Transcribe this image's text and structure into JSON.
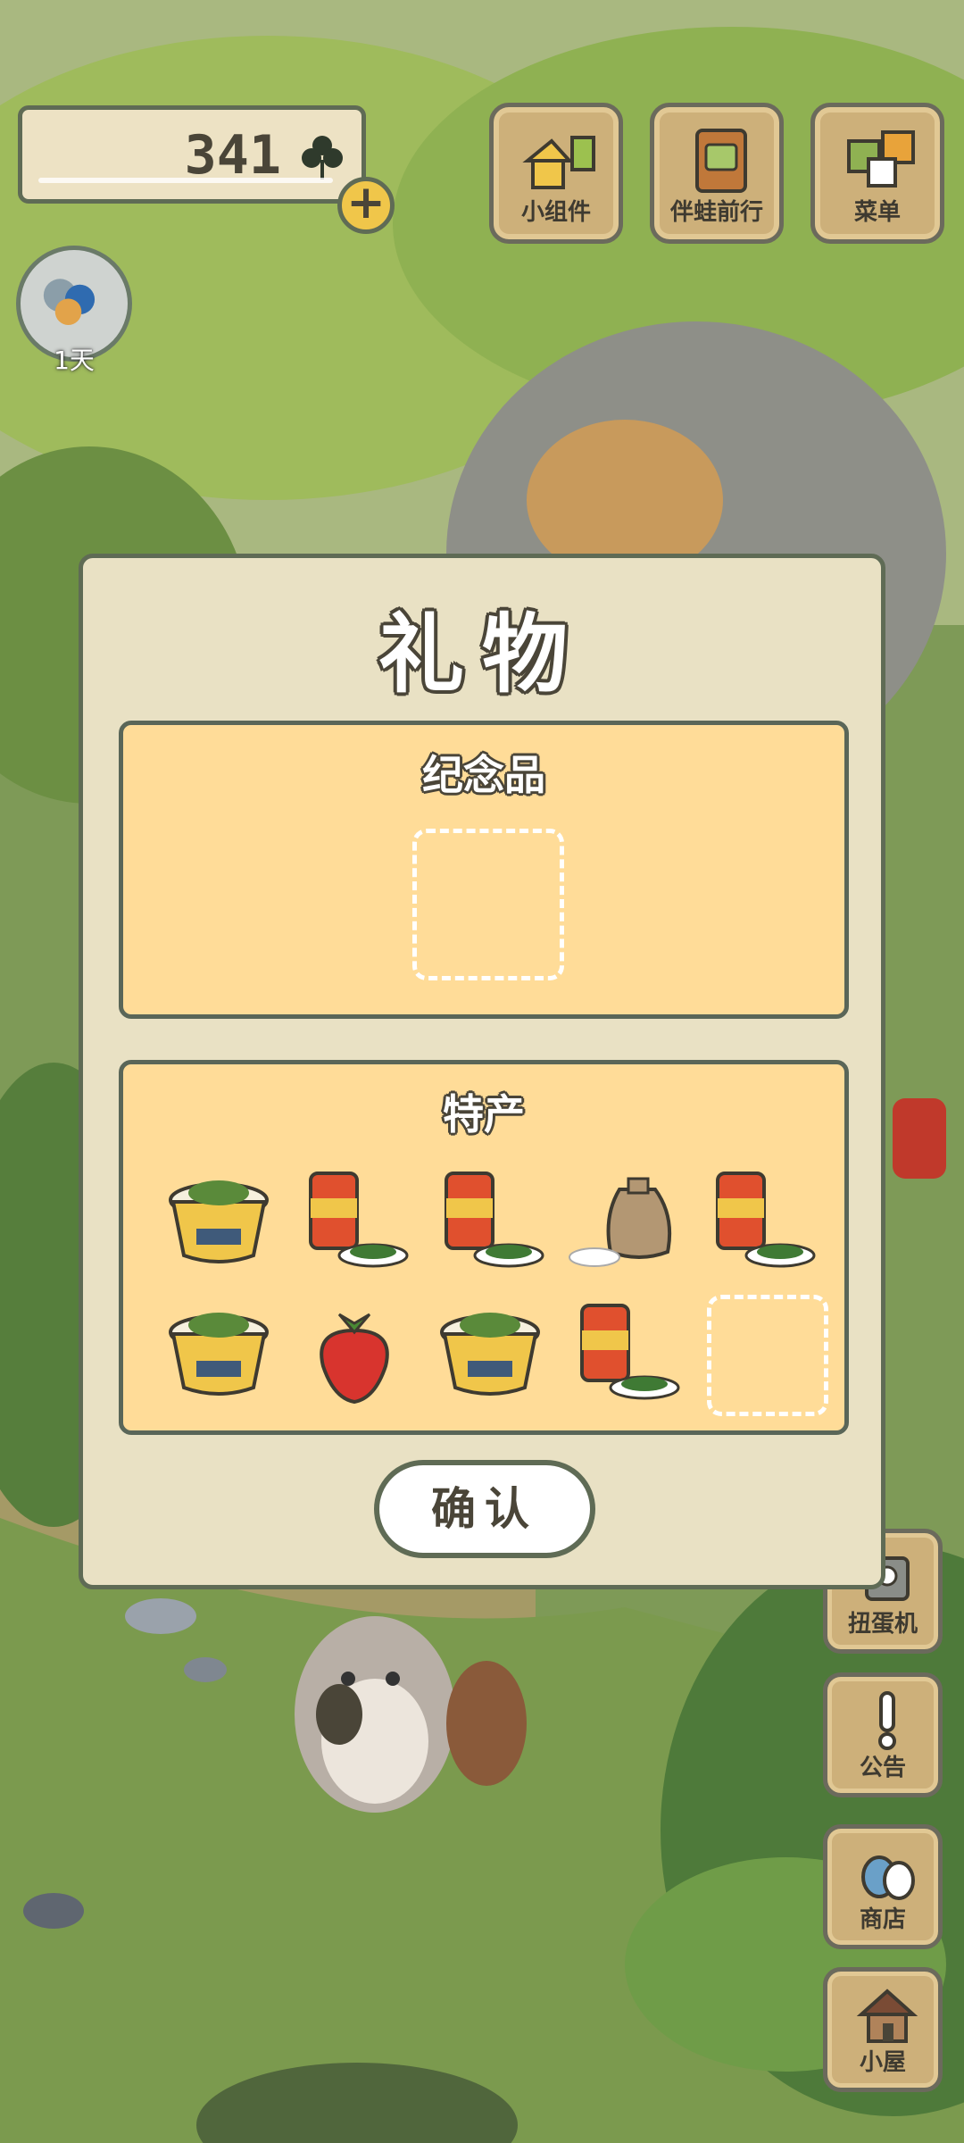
{
  "currency": {
    "amount": "341",
    "icon": "clover-icon"
  },
  "add_label": "+",
  "calendar": {
    "days": "1天"
  },
  "top_menu": [
    {
      "label": "小组件",
      "icon": "widget-icon"
    },
    {
      "label": "伴蛙前行",
      "icon": "journey-book-icon"
    },
    {
      "label": "菜单",
      "icon": "menu-cards-icon"
    }
  ],
  "side_menu": [
    {
      "label": "扭蛋机",
      "icon": "gacha-machine-icon"
    },
    {
      "label": "公告",
      "icon": "exclamation-icon"
    },
    {
      "label": "商店",
      "icon": "shop-bags-icon"
    },
    {
      "label": "小屋",
      "icon": "house-icon"
    }
  ],
  "dialog": {
    "title": "礼物",
    "souvenir_title": "纪念品",
    "specialty_title": "特产",
    "specialty_items": [
      "noodle-bowl",
      "drink-can-with-dish",
      "drink-can-with-dish",
      "rice-sack",
      "drink-can-with-dish",
      "noodle-bowl",
      "strawberry",
      "noodle-bowl",
      "drink-can-with-dish",
      "empty"
    ],
    "confirm_label": "确认"
  },
  "colors": {
    "panel": "#ffdc98",
    "dialog": "#e9e1c4",
    "border": "#5f6b55",
    "button_wood": "#cdb07a"
  }
}
